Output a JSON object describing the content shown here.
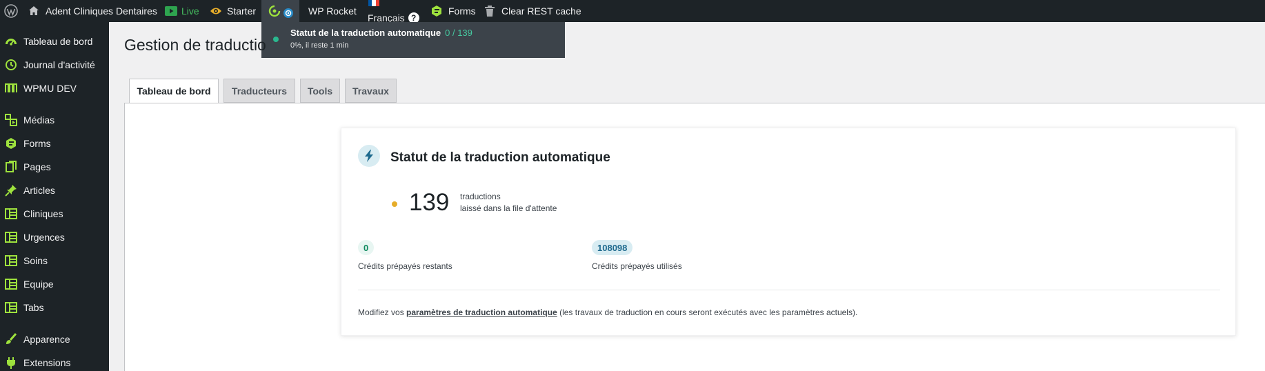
{
  "admin_bar": {
    "site_name": "Adent Cliniques Dentaires",
    "live_label": "Live",
    "starter_label": "Starter",
    "wp_rocket_label": "WP Rocket",
    "language_label": "Français",
    "forms_label": "Forms",
    "clear_cache_label": "Clear REST cache"
  },
  "translation_status_dropdown": {
    "title": "Statut de la traduction automatique",
    "count": "0 / 139",
    "progress_text": "0%, il reste 1 min"
  },
  "sidebar": {
    "items": [
      {
        "label": "Tableau de bord",
        "icon": "dashboard-icon"
      },
      {
        "label": "Journal d'activité",
        "icon": "history-icon"
      },
      {
        "label": "WPMU DEV",
        "icon": "wpmudev-icon"
      },
      {
        "label": "Médias",
        "icon": "media-icon"
      },
      {
        "label": "Forms",
        "icon": "forms-icon"
      },
      {
        "label": "Pages",
        "icon": "pages-icon"
      },
      {
        "label": "Articles",
        "icon": "pin-icon"
      },
      {
        "label": "Cliniques",
        "icon": "layout-icon"
      },
      {
        "label": "Urgences",
        "icon": "layout-icon"
      },
      {
        "label": "Soins",
        "icon": "layout-icon"
      },
      {
        "label": "Equipe",
        "icon": "layout-icon"
      },
      {
        "label": "Tabs",
        "icon": "layout-icon"
      },
      {
        "label": "Apparence",
        "icon": "brush-icon"
      },
      {
        "label": "Extensions",
        "icon": "plugin-icon"
      }
    ]
  },
  "page": {
    "title": "Gestion de traductio",
    "tabs": [
      {
        "label": "Tableau de bord",
        "active": true
      },
      {
        "label": "Traducteurs",
        "active": false
      },
      {
        "label": "Tools",
        "active": false
      },
      {
        "label": "Travaux",
        "active": false
      }
    ]
  },
  "card": {
    "title": "Statut de la traduction automatique",
    "queue_count": "139",
    "queue_unit": "traductions",
    "queue_desc": "laissé dans la file d'attente",
    "credits_left_value": "0",
    "credits_left_label": "Crédits prépayés restants",
    "credits_used_value": "108098",
    "credits_used_label": "Crédits prépayés utilisés",
    "footer_prefix": "Modifiez vos ",
    "footer_link": "paramètres de traduction automatique",
    "footer_suffix": " (les travaux de traduction en cours seront exécutés avec les paramètres actuels)."
  },
  "colors": {
    "admin_bar_bg": "#1d2327",
    "accent_green": "#46c9a0",
    "sidebar_icon_green": "#9ee23d",
    "queue_dot": "#e6ad2a"
  }
}
